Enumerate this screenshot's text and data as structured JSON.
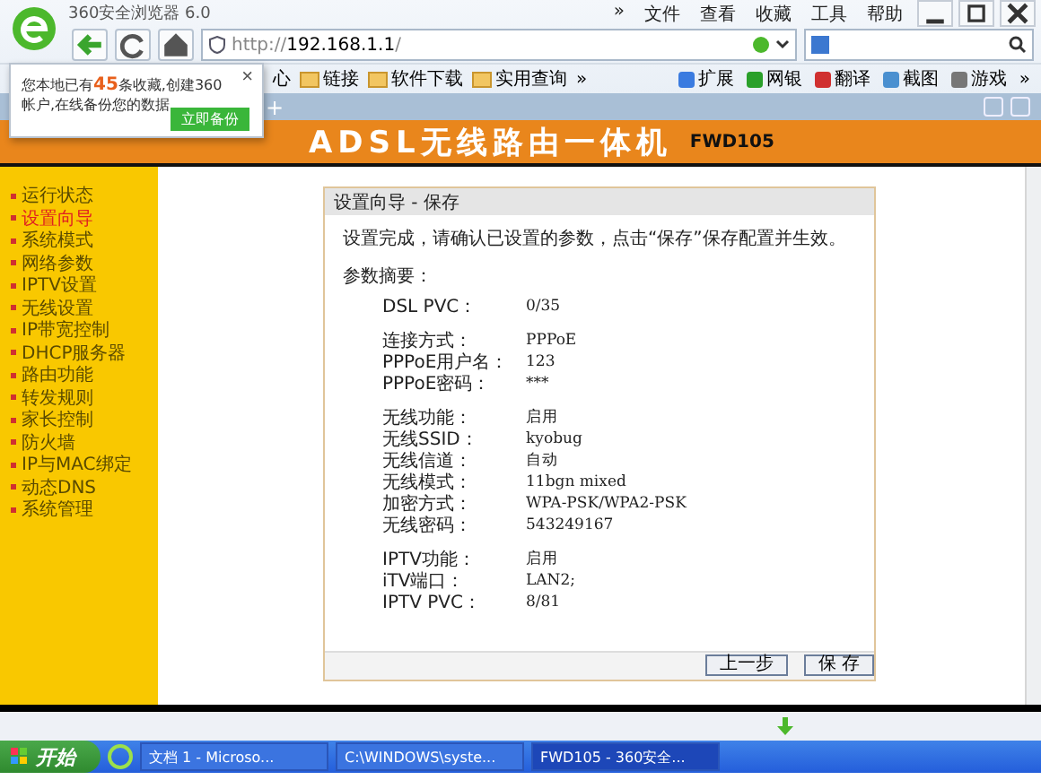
{
  "browser": {
    "title": "360安全浏览器 6.0",
    "menu": [
      "»",
      "文件",
      "查看",
      "收藏",
      "工具",
      "帮助"
    ],
    "address": {
      "prefix": "http://",
      "host": "192.168.1.1",
      "suffix": "/"
    },
    "bookmarks": [
      "心",
      "链接",
      "软件下载",
      "实用查询"
    ],
    "bookmarks_more": "»",
    "tools": [
      {
        "label": "扩展",
        "color": "#3a7be0"
      },
      {
        "label": "网银",
        "color": "#2aa02a"
      },
      {
        "label": "翻译",
        "color": "#d03030"
      },
      {
        "label": "截图",
        "color": "#4a90d0"
      },
      {
        "label": "游戏",
        "color": "#777777"
      }
    ],
    "tools_more": "»",
    "new_tab": "+"
  },
  "popup": {
    "message": "您本地已有**45**条收藏,创建360帐户,在线备份您的数据",
    "button": "立即备份",
    "close": "×"
  },
  "page": {
    "header_title": "ADSL无线路由一体机",
    "model": "FWD105",
    "sidebar": [
      {
        "label": "运行状态",
        "selected": false
      },
      {
        "label": "设置向导",
        "selected": true
      },
      {
        "label": "系统模式",
        "selected": false
      },
      {
        "label": "网络参数",
        "selected": false
      },
      {
        "label": "IPTV设置",
        "selected": false
      },
      {
        "label": "无线设置",
        "selected": false
      },
      {
        "label": "IP带宽控制",
        "selected": false
      },
      {
        "label": "DHCP服务器",
        "selected": false
      },
      {
        "label": "路由功能",
        "selected": false
      },
      {
        "label": "转发规则",
        "selected": false
      },
      {
        "label": "家长控制",
        "selected": false
      },
      {
        "label": "防火墙",
        "selected": false
      },
      {
        "label": "IP与MAC绑定",
        "selected": false
      },
      {
        "label": "动态DNS",
        "selected": false
      },
      {
        "label": "系统管理",
        "selected": false
      }
    ],
    "panel": {
      "title": "设置向导 - 保存",
      "intro": "设置完成，请确认已设置的参数，点击“保存”保存配置并生效。",
      "summary_label": "参数摘要：",
      "groups": [
        [
          {
            "label": "DSL PVC：",
            "value": "0/35"
          }
        ],
        [
          {
            "label": "连接方式：",
            "value": "PPPoE"
          },
          {
            "label": "PPPoE用户名：",
            "value": "123"
          },
          {
            "label": "PPPoE密码：",
            "value": "***"
          }
        ],
        [
          {
            "label": "无线功能：",
            "value": "启用"
          },
          {
            "label": "无线SSID：",
            "value": "kyobug"
          },
          {
            "label": "无线信道：",
            "value": "自动"
          },
          {
            "label": "无线模式：",
            "value": "11bgn mixed"
          },
          {
            "label": "加密方式：",
            "value": "WPA-PSK/WPA2-PSK"
          },
          {
            "label": "无线密码：",
            "value": "543249167"
          }
        ],
        [
          {
            "label": "IPTV功能：",
            "value": "启用"
          },
          {
            "label": "iTV端口：",
            "value": "LAN2;"
          },
          {
            "label": "IPTV PVC：",
            "value": "8/81"
          }
        ]
      ],
      "buttons": [
        "上一步",
        "保 存"
      ]
    }
  },
  "taskbar": {
    "start": "开始",
    "tasks": [
      {
        "label": "文档 1 - Microso...",
        "selected": false
      },
      {
        "label": "C:\\WINDOWS\\syste...",
        "selected": false
      },
      {
        "label": "FWD105 - 360安全...",
        "selected": true
      }
    ]
  }
}
